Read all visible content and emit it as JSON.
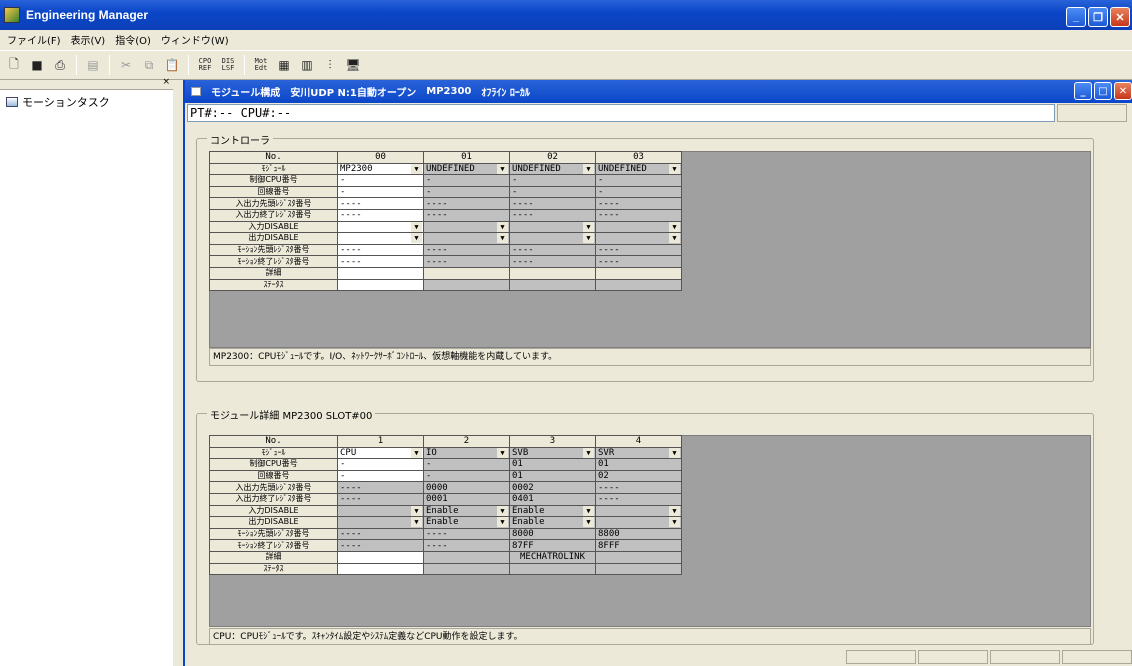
{
  "app": {
    "title": "Engineering Manager"
  },
  "menu": [
    "ファイル(F)",
    "表示(V)",
    "指令(O)",
    "ウィンドウ(W)"
  ],
  "toolbar": {
    "buttons": [
      "new-icon",
      "save-icon",
      "print-icon",
      "copy-icon",
      "cut-icon",
      "paste-icon"
    ],
    "cpo_ref": [
      "CPO",
      "REF"
    ],
    "dis_lsf": [
      "DIS",
      "LSF"
    ],
    "mot_edt": [
      "Mot",
      "Edt"
    ]
  },
  "left_panel": {
    "close": "×",
    "tree_item": "モーションタスク"
  },
  "child": {
    "title_parts": [
      "モジュール構成",
      "安川UDP N:1自動オープン",
      "MP2300",
      "ｵﾌﾗｲﾝ ﾛｰｶﾙ"
    ],
    "pt_line": "PT#:-- CPU#:--"
  },
  "controller": {
    "group_label": "コントローラ",
    "header_no": "No.",
    "slots": [
      "00",
      "01",
      "02",
      "03"
    ],
    "row_labels": [
      "ﾓｼﾞｭｰﾙ",
      "制御CPU番号",
      "回線番号",
      "入出力先頭ﾚｼﾞｽﾀ番号",
      "入出力終了ﾚｼﾞｽﾀ番号",
      "入力DISABLE",
      "出力DISABLE",
      "ﾓｰｼｮﾝ先頭ﾚｼﾞｽﾀ番号",
      "ﾓｰｼｮﾝ終了ﾚｼﾞｽﾀ番号",
      "詳細",
      "ｽﾃｰﾀｽ"
    ],
    "rows": [
      [
        "MP2300",
        "UNDEFINED",
        "UNDEFINED",
        "UNDEFINED"
      ],
      [
        "-",
        "-",
        "-",
        "-"
      ],
      [
        "-",
        "-",
        "-",
        "-"
      ],
      [
        "----",
        "----",
        "----",
        "----"
      ],
      [
        "----",
        "----",
        "----",
        "----"
      ],
      [
        "",
        "",
        "",
        ""
      ],
      [
        "",
        "",
        "",
        ""
      ],
      [
        "----",
        "----",
        "----",
        "----"
      ],
      [
        "----",
        "----",
        "----",
        "----"
      ],
      [
        "",
        "",
        "",
        ""
      ],
      [
        "",
        "",
        "",
        ""
      ]
    ],
    "info": "MP2300：CPUﾓｼﾞｭｰﾙです。I/O、ﾈｯﾄﾜｰｸｻｰﾎﾞｺﾝﾄﾛｰﾙ、仮想軸機能を内蔵しています。"
  },
  "detail": {
    "group_label": "モジュール詳細 MP2300 SLOT#00",
    "header_no": "No.",
    "slots": [
      "1",
      "2",
      "3",
      "4"
    ],
    "rows": [
      [
        "CPU",
        "IO",
        "SVB",
        "SVR"
      ],
      [
        "-",
        "-",
        "01",
        "01"
      ],
      [
        "-",
        "-",
        "01",
        "02"
      ],
      [
        "----",
        "0000",
        "0002",
        "----"
      ],
      [
        "----",
        "0001",
        "0401",
        "----"
      ],
      [
        "",
        "Enable",
        "Enable",
        ""
      ],
      [
        "",
        "Enable",
        "Enable",
        ""
      ],
      [
        "----",
        "----",
        "8000",
        "8800"
      ],
      [
        "----",
        "----",
        "87FF",
        "8FFF"
      ],
      [
        "",
        "",
        "MECHATROLINK",
        ""
      ],
      [
        "",
        "",
        "",
        ""
      ]
    ],
    "info": "CPU：CPUﾓｼﾞｭｰﾙです。ｽｷｬﾝﾀｲﾑ設定やｼｽﾃﾑ定義などCPU動作を設定します。"
  }
}
